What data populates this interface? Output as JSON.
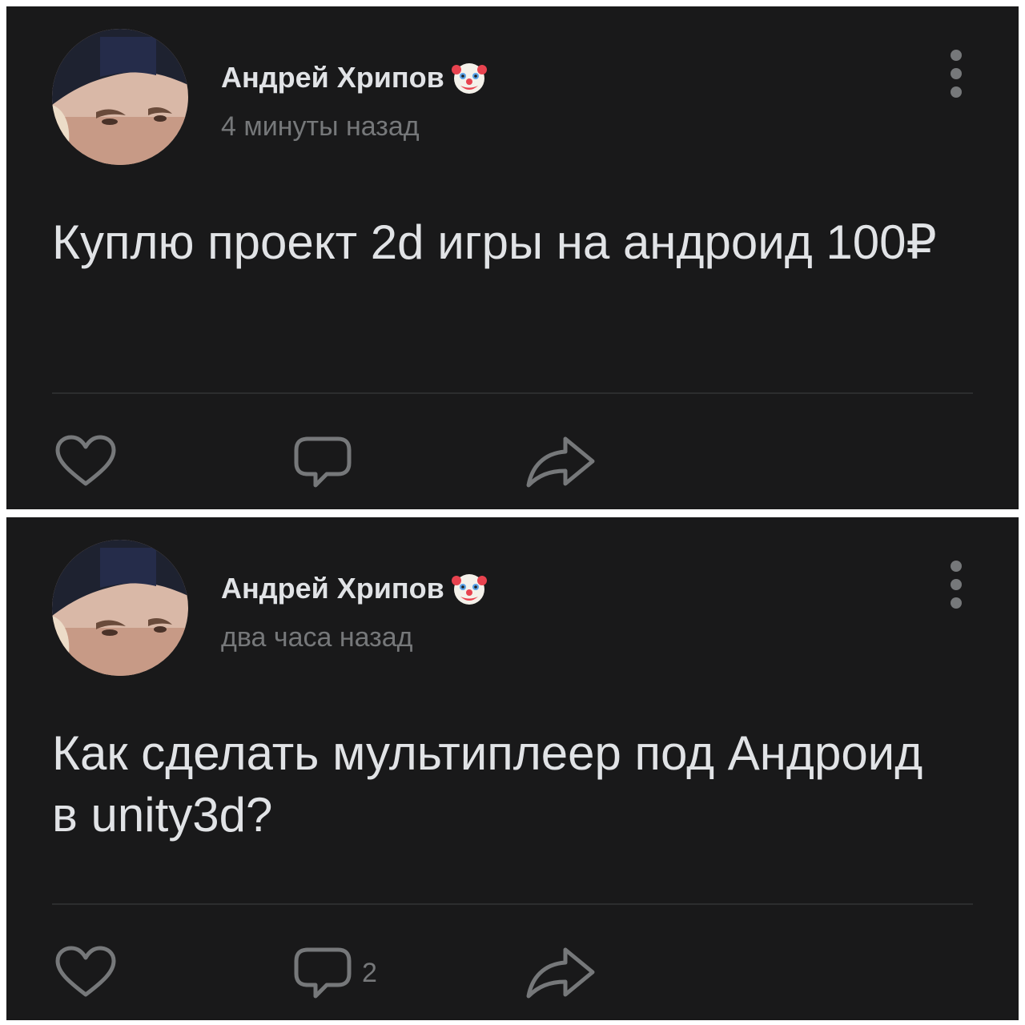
{
  "posts": [
    {
      "author": "Андрей Хрипов",
      "author_emoji": "clown-face-icon",
      "time": "4 минуты назад",
      "text": "Куплю проект 2d игры на андроид 100₽",
      "comment_count": ""
    },
    {
      "author": "Андрей Хрипов",
      "author_emoji": "clown-face-icon",
      "time": "два часа назад",
      "text": "Как сделать мультиплеер под Андроид в unity3d?",
      "comment_count": "2"
    }
  ],
  "colors": {
    "background": "#19191a",
    "primary_text": "#e1e3e6",
    "secondary_text": "#76787a",
    "divider": "#2c2d2e"
  },
  "icons": {
    "like": "heart-icon",
    "comment": "comment-bubble-icon",
    "share": "share-arrow-icon",
    "more": "more-vertical-icon"
  }
}
